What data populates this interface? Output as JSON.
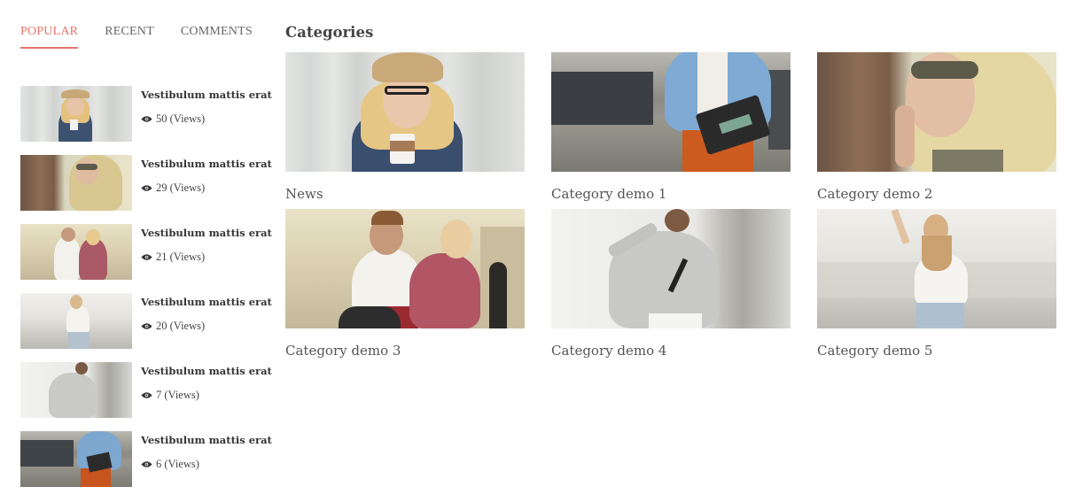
{
  "sidebar": {
    "tabs": [
      {
        "label": "POPULAR",
        "active": true
      },
      {
        "label": "RECENT",
        "active": false
      },
      {
        "label": "COMMENTS",
        "active": false
      }
    ],
    "posts": [
      {
        "title": "Vestibulum mattis erat",
        "views": "50 (Views)",
        "image": "woman-hat-coffee"
      },
      {
        "title": "Vestibulum mattis erat",
        "views": "29 (Views)",
        "image": "woman-sunglasses-tree"
      },
      {
        "title": "Vestibulum mattis erat",
        "views": "21 (Views)",
        "image": "couple-street"
      },
      {
        "title": "Vestibulum mattis erat",
        "views": "20 (Views)",
        "image": "woman-city-haze"
      },
      {
        "title": "Vestibulum mattis erat",
        "views": "7 (Views)",
        "image": "man-grey-sweater"
      },
      {
        "title": "Vestibulum mattis erat",
        "views": "6 (Views)",
        "image": "man-clutch-street"
      }
    ],
    "view_icon": "eye-icon"
  },
  "categories": {
    "heading": "Categories",
    "items": [
      {
        "label": "News",
        "image": "woman-hat-coffee"
      },
      {
        "label": "Category demo 1",
        "image": "man-clutch-street"
      },
      {
        "label": "Category demo 2",
        "image": "woman-sunglasses-tree"
      },
      {
        "label": "Category demo 3",
        "image": "couple-street"
      },
      {
        "label": "Category demo 4",
        "image": "man-grey-sweater"
      },
      {
        "label": "Category demo 5",
        "image": "woman-city-haze"
      }
    ]
  },
  "colors": {
    "accent": "#e8746a",
    "text": "#444444",
    "muted": "#666666"
  }
}
